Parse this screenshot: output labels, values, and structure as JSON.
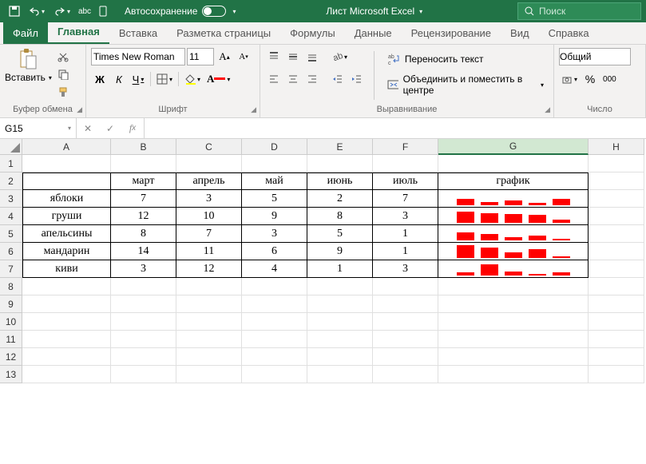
{
  "titlebar": {
    "autosave_label": "Автосохранение",
    "title": "Лист Microsoft Excel",
    "search_placeholder": "Поиск"
  },
  "tabs": {
    "file": "Файл",
    "home": "Главная",
    "insert": "Вставка",
    "layout": "Разметка страницы",
    "formulas": "Формулы",
    "data": "Данные",
    "review": "Рецензирование",
    "view": "Вид",
    "help": "Справка"
  },
  "ribbon": {
    "clipboard": {
      "title": "Буфер обмена",
      "paste": "Вставить"
    },
    "font": {
      "title": "Шрифт",
      "name": "Times New Roman",
      "size": "11",
      "bold": "Ж",
      "italic": "К",
      "underline": "Ч"
    },
    "alignment": {
      "title": "Выравнивание",
      "wrap": "Переносить текст",
      "merge": "Объединить и поместить в центре"
    },
    "number": {
      "title": "Число",
      "format": "Общий",
      "percent": "%",
      "thousands": "000"
    }
  },
  "formula_bar": {
    "cell_ref": "G15",
    "formula": ""
  },
  "columns": [
    "A",
    "B",
    "C",
    "D",
    "E",
    "F",
    "G",
    "H"
  ],
  "rows": [
    1,
    2,
    3,
    4,
    5,
    6,
    7,
    8,
    9,
    10,
    11,
    12,
    13
  ],
  "table": {
    "header": [
      "",
      "март",
      "апрель",
      "май",
      "июнь",
      "июль",
      "график"
    ],
    "rows": [
      {
        "label": "яблоки",
        "values": [
          7,
          3,
          5,
          2,
          7
        ]
      },
      {
        "label": "груши",
        "values": [
          12,
          10,
          9,
          8,
          3
        ]
      },
      {
        "label": "апельсины",
        "values": [
          8,
          7,
          3,
          5,
          1
        ]
      },
      {
        "label": "мандарин",
        "values": [
          14,
          11,
          6,
          9,
          1
        ]
      },
      {
        "label": "киви",
        "values": [
          3,
          12,
          4,
          1,
          3
        ]
      }
    ]
  },
  "chart_data": {
    "type": "bar",
    "note": "Inline sparkline-style bar charts in column G, one per row",
    "categories": [
      "март",
      "апрель",
      "май",
      "июнь",
      "июль"
    ],
    "series": [
      {
        "name": "яблоки",
        "values": [
          7,
          3,
          5,
          2,
          7
        ]
      },
      {
        "name": "груши",
        "values": [
          12,
          10,
          9,
          8,
          3
        ]
      },
      {
        "name": "апельсины",
        "values": [
          8,
          7,
          3,
          5,
          1
        ]
      },
      {
        "name": "мандарин",
        "values": [
          14,
          11,
          6,
          9,
          1
        ]
      },
      {
        "name": "киви",
        "values": [
          3,
          12,
          4,
          1,
          3
        ]
      }
    ],
    "color": "#ff0000"
  }
}
